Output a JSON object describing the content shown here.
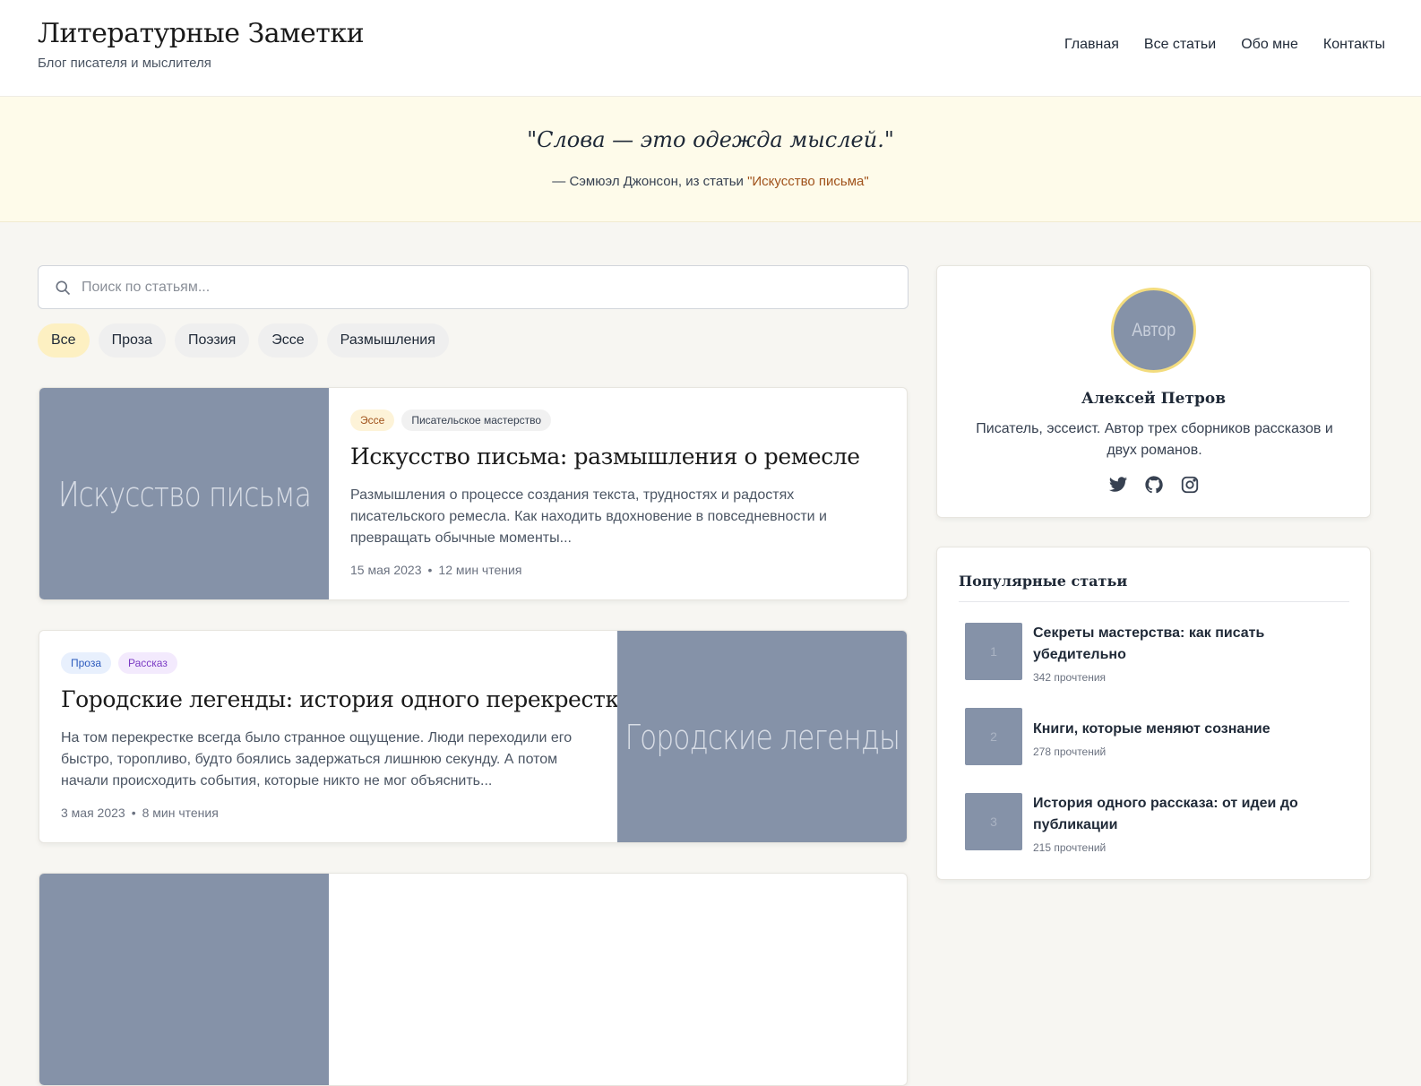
{
  "header": {
    "title": "Литературные Заметки",
    "subtitle": "Блог писателя и мыслителя",
    "nav": [
      "Главная",
      "Все статьи",
      "Обо мне",
      "Контакты"
    ]
  },
  "quote": {
    "text": "\"Слова — это одежда мыслей.\"",
    "source_prefix": "— Сэмюэл Джонсон, из статьи ",
    "source_link": "\"Искусство письма\""
  },
  "search": {
    "placeholder": "Поиск по статьям...",
    "value": ""
  },
  "filters": {
    "items": [
      "Все",
      "Проза",
      "Поэзия",
      "Эссе",
      "Размышления"
    ],
    "active": "Все"
  },
  "articles": [
    {
      "image_text": "Искусство письма",
      "tags": [
        "Эссе",
        "Писательское мастерство"
      ],
      "title": "Искусство письма: размышления о ремесле",
      "excerpt": "Размышления о процессе создания текста, трудностях и радостях писательского ремесла. Как находить вдохновение в повседневности и превращать обычные моменты...",
      "date": "15 мая 2023",
      "read_time": "12 мин чтения"
    },
    {
      "image_text": "Городские легенды",
      "tags": [
        "Проза",
        "Рассказ"
      ],
      "title": "Городские легенды: история одного перекрестка",
      "excerpt": "На том перекрестке всегда было странное ощущение. Люди переходили его быстро, торопливо, будто боялись задержаться лишнюю секунду. А потом начали происходить события, которые никто не мог объяснить...",
      "date": "3 мая 2023",
      "read_time": "8 мин чтения"
    }
  ],
  "author": {
    "avatar_text": "Автор",
    "name": "Алексей Петров",
    "bio": "Писатель, эссеист. Автор трех сборников рассказов и двух романов.",
    "socials": [
      "twitter-icon",
      "github-icon",
      "instagram-icon"
    ]
  },
  "popular": {
    "title": "Популярные статьи",
    "items": [
      {
        "rank": "1",
        "title": "Секреты мастерства: как писать убедительно",
        "reads": "342 прочтения"
      },
      {
        "rank": "2",
        "title": "Книги, которые меняют сознание",
        "reads": "278 прочтений"
      },
      {
        "rank": "3",
        "title": "История одного рассказа: от идеи до публикации",
        "reads": "215 прочтений"
      }
    ]
  },
  "colors": {
    "accent": "#a0521b",
    "quote_band": "#fefbea",
    "placeholder_image": "#8592a8",
    "active_chip": "#fdf0c2"
  }
}
